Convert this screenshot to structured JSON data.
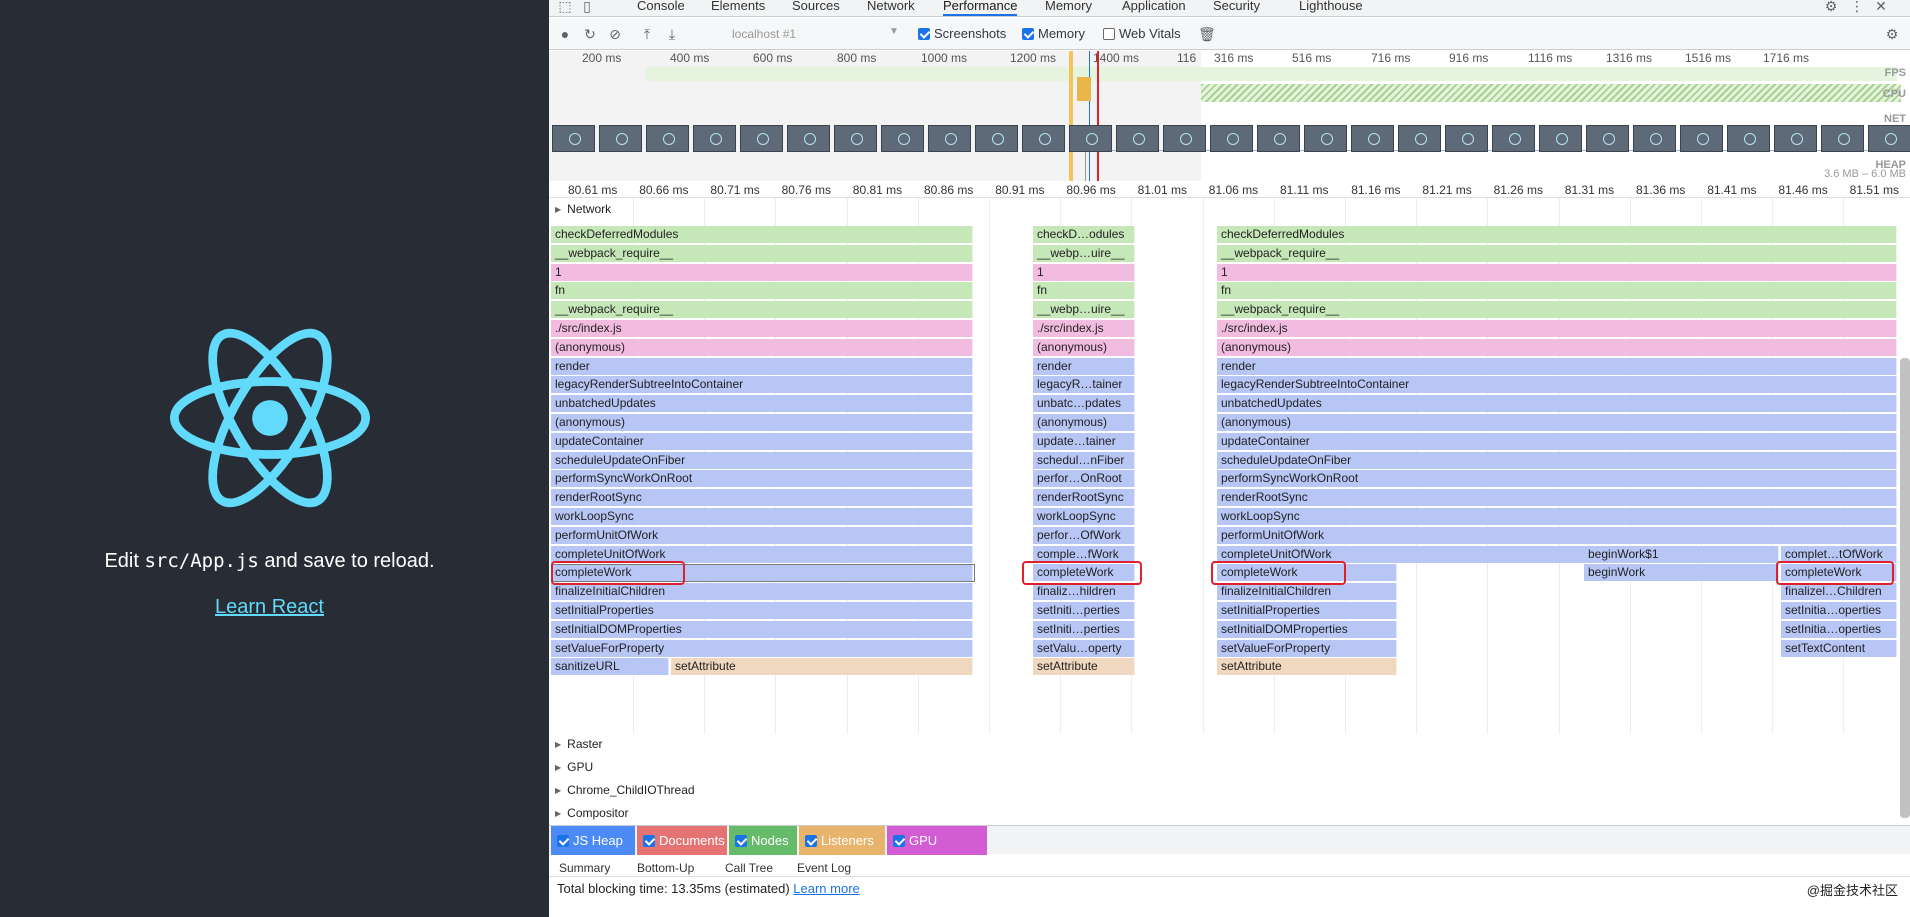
{
  "app": {
    "edit_prefix": "Edit ",
    "edit_code": "src/App.js",
    "edit_suffix": " and save to reload.",
    "learn_link": "Learn React",
    "logo": "react-logo-icon",
    "brand_color": "#61dafb",
    "background": "#282c34"
  },
  "devtools": {
    "tabs": [
      "Console",
      "Elements",
      "Sources",
      "Network",
      "Performance",
      "Memory",
      "Application",
      "Security",
      "Lighthouse"
    ],
    "active_tab": "Performance",
    "toolbar": {
      "target": "localhost #1",
      "screenshots": "Screenshots",
      "memory": "Memory",
      "web_vitals": "Web Vitals",
      "screenshots_on": true,
      "memory_on": true,
      "web_vitals_on": false
    },
    "overview_ticks_left": [
      "200 ms",
      "400 ms",
      "600 ms",
      "800 ms",
      "1000 ms",
      "1200 ms",
      "1400 ms",
      "116"
    ],
    "overview_ticks_right": [
      "316 ms",
      "516 ms",
      "716 ms",
      "916 ms",
      "1116 ms",
      "1316 ms",
      "1516 ms",
      "1716 ms"
    ],
    "overview_labels": [
      "FPS",
      "CPU",
      "NET",
      "HEAP"
    ],
    "heap_range": "3.6 MB – 6.0 MB",
    "ruler_ticks": [
      "80.61 ms",
      "80.66 ms",
      "80.71 ms",
      "80.76 ms",
      "80.81 ms",
      "80.86 ms",
      "80.91 ms",
      "80.96 ms",
      "81.01 ms",
      "81.06 ms",
      "81.11 ms",
      "81.16 ms",
      "81.21 ms",
      "81.26 ms",
      "81.31 ms",
      "81.36 ms",
      "81.41 ms",
      "81.46 ms",
      "81.51 ms"
    ],
    "tracks": [
      "Network",
      "Raster",
      "GPU",
      "Chrome_ChildIOThread",
      "Compositor"
    ],
    "flame_colors": {
      "g": "#c6e8b9",
      "p": "#f2bce0",
      "b": "#b7c6f5",
      "o": "#f0d8c0"
    },
    "flame_groups": [
      {
        "rows": [
          [
            "checkDeferredModules",
            "g"
          ],
          [
            "__webpack_require__",
            "g"
          ],
          [
            "1",
            "p"
          ],
          [
            "fn",
            "g"
          ],
          [
            "__webpack_require__",
            "g"
          ],
          [
            "./src/index.js",
            "p"
          ],
          [
            "(anonymous)",
            "p"
          ],
          [
            "render",
            "b"
          ],
          [
            "legacyRenderSubtreeIntoContainer",
            "b"
          ],
          [
            "unbatchedUpdates",
            "b"
          ],
          [
            "(anonymous)",
            "b"
          ],
          [
            "updateContainer",
            "b"
          ],
          [
            "scheduleUpdateOnFiber",
            "b"
          ],
          [
            "performSyncWorkOnRoot",
            "b"
          ],
          [
            "renderRootSync",
            "b"
          ],
          [
            "workLoopSync",
            "b"
          ],
          [
            "performUnitOfWork",
            "b"
          ],
          [
            "completeUnitOfWork",
            "b"
          ],
          [
            "completeWork",
            "b"
          ],
          [
            "finalizeInitialChildren",
            "b"
          ],
          [
            "setInitialProperties",
            "b"
          ],
          [
            "setInitialDOMProperties",
            "b"
          ],
          [
            "setValueForProperty",
            "b"
          ],
          [
            "sanitizeURL",
            "b"
          ]
        ]
      },
      {
        "rows": [
          [
            "checkD…odules",
            "g"
          ],
          [
            "__webp…uire__",
            "g"
          ],
          [
            "1",
            "p"
          ],
          [
            "fn",
            "g"
          ],
          [
            "__webp…uire__",
            "g"
          ],
          [
            "./src/index.js",
            "p"
          ],
          [
            "(anonymous)",
            "p"
          ],
          [
            "render",
            "b"
          ],
          [
            "legacyR…tainer",
            "b"
          ],
          [
            "unbatc…pdates",
            "b"
          ],
          [
            "(anonymous)",
            "b"
          ],
          [
            "update…tainer",
            "b"
          ],
          [
            "schedul…nFiber",
            "b"
          ],
          [
            "perfor…OnRoot",
            "b"
          ],
          [
            "renderRootSync",
            "b"
          ],
          [
            "workLoopSync",
            "b"
          ],
          [
            "perfor…OfWork",
            "b"
          ],
          [
            "comple…fWork",
            "b"
          ],
          [
            "completeWork",
            "b"
          ],
          [
            "finaliz…hildren",
            "b"
          ],
          [
            "setIniti…perties",
            "b"
          ],
          [
            "setIniti…perties",
            "b"
          ],
          [
            "setValu…operty",
            "b"
          ],
          [
            "setAttribute",
            "o"
          ]
        ]
      },
      {
        "rows": [
          [
            "checkDeferredModules",
            "g"
          ],
          [
            "__webpack_require__",
            "g"
          ],
          [
            "1",
            "p"
          ],
          [
            "fn",
            "g"
          ],
          [
            "__webpack_require__",
            "g"
          ],
          [
            "./src/index.js",
            "p"
          ],
          [
            "(anonymous)",
            "p"
          ],
          [
            "render",
            "b"
          ],
          [
            "legacyRenderSubtreeIntoContainer",
            "b"
          ],
          [
            "unbatchedUpdates",
            "b"
          ],
          [
            "(anonymous)",
            "b"
          ],
          [
            "updateContainer",
            "b"
          ],
          [
            "scheduleUpdateOnFiber",
            "b"
          ],
          [
            "performSyncWorkOnRoot",
            "b"
          ],
          [
            "renderRootSync",
            "b"
          ],
          [
            "workLoopSync",
            "b"
          ],
          [
            "performUnitOfWork",
            "b"
          ],
          [
            "completeUnitOfWork",
            "b"
          ],
          [
            "completeWork",
            "b"
          ],
          [
            "finalizeInitialChildren",
            "b"
          ],
          [
            "setInitialProperties",
            "b"
          ],
          [
            "setInitialDOMProperties",
            "b"
          ],
          [
            "setValueForProperty",
            "b"
          ],
          [
            "setAttribute",
            "o"
          ]
        ]
      }
    ],
    "extra_bars": {
      "set_attribute_1": "setAttribute",
      "begin_work_1": "beginWork$1",
      "begin_work": "beginWork",
      "complet_of_work": "complet…tOfWork",
      "complete_work": "completeWork",
      "finalizel_children": "finalizel…Children",
      "setinitia_1": "setInitia…operties",
      "setinitia_2": "setInitia…operties",
      "set_text_content": "setTextContent"
    },
    "legend": [
      [
        "JS Heap",
        "#4c8bf5"
      ],
      [
        "Documents",
        "#e57373"
      ],
      [
        "Nodes",
        "#66bb6a"
      ],
      [
        "Listeners",
        "#e8b36a"
      ],
      [
        "GPU Memory",
        "#d25cd2"
      ]
    ],
    "subtabs": [
      "Summary",
      "Bottom-Up",
      "Call Tree",
      "Event Log"
    ],
    "blocking_prefix": "Total blocking time: 13.35ms (estimated)",
    "learn_more": "Learn more",
    "watermark": "@掘金技术社区"
  }
}
